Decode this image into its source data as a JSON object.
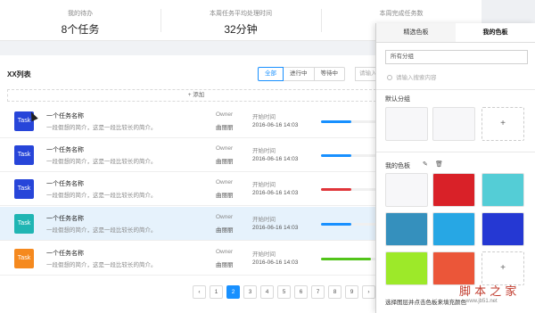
{
  "stats": [
    {
      "label": "我的待办",
      "value": "8个任务"
    },
    {
      "label": "本周任务平均处理时间",
      "value": "32分钟"
    },
    {
      "label": "本周完成任务数",
      "value": ""
    }
  ],
  "list": {
    "title": "XX列表",
    "filters": [
      "全部",
      "进行中",
      "等待中"
    ],
    "search_placeholder": "请输入",
    "add_label": "+ 添加"
  },
  "rows": [
    {
      "icon": "Task",
      "color": "#2745d9",
      "name": "一个任务名称",
      "desc": "一段假想的简介，这是一段比较长的简介。",
      "owner_label": "Owner",
      "owner": "曲丽丽",
      "time_label": "开始时间",
      "time": "2016-06-16 14:03",
      "progress": 0.55,
      "bar_color": "#1890ff"
    },
    {
      "icon": "Task",
      "color": "#2745d9",
      "name": "一个任务名称",
      "desc": "一段假想的简介，这是一段比较长的简介。",
      "owner_label": "Owner",
      "owner": "曲丽丽",
      "time_label": "开始时间",
      "time": "2016-06-16 14:03",
      "progress": 0.55,
      "bar_color": "#1890ff"
    },
    {
      "icon": "Task",
      "color": "#2745d9",
      "name": "一个任务名称",
      "desc": "一段假想的简介，这是一段比较长的简介。",
      "owner_label": "Owner",
      "owner": "曲丽丽",
      "time_label": "开始时间",
      "time": "2016-06-16 14:03",
      "progress": 0.55,
      "bar_color": "#e0353a"
    },
    {
      "icon": "Task",
      "color": "#20b5b3",
      "name": "一个任务名称",
      "desc": "一段假想的简介，这是一段比较长的简介。",
      "owner_label": "Owner",
      "owner": "曲丽丽",
      "time_label": "开始时间",
      "time": "2016-06-16 14:03",
      "progress": 0.55,
      "bar_color": "#1890ff"
    },
    {
      "icon": "Task",
      "color": "#f5891e",
      "name": "一个任务名称",
      "desc": "一段假想的简介，这是一段比较长的简介。",
      "owner_label": "Owner",
      "owner": "曲丽丽",
      "time_label": "开始时间",
      "time": "2016-06-16 14:03",
      "progress": 0.9,
      "bar_color": "#52c41a"
    }
  ],
  "pagination": {
    "prev": "‹",
    "pages": [
      "1",
      "2",
      "3",
      "4",
      "5",
      "6",
      "7",
      "8",
      "9"
    ],
    "next": "›",
    "active": "2"
  },
  "panel": {
    "tabs": [
      "精选色板",
      "我的色板"
    ],
    "group_select": "所有分组",
    "search_placeholder": "请输入搜索内容",
    "default_group_title": "默认分组",
    "add_symbol": "+",
    "my_palette_title": "我的色板",
    "edit_icon": "✎",
    "delete_icon": "🗑",
    "colors": [
      "#f7f7f9",
      "#d92128",
      "#54cdd6",
      "#3590bd",
      "#27a7e4",
      "#2538d3",
      "#9de929",
      "#eb5639"
    ],
    "footer": "选择图层并点击色板来填充颜色"
  },
  "watermark": {
    "text": "脚 本 之 家",
    "url": "www.jb51.net"
  },
  "colors": {
    "accent": "#1890ff"
  }
}
